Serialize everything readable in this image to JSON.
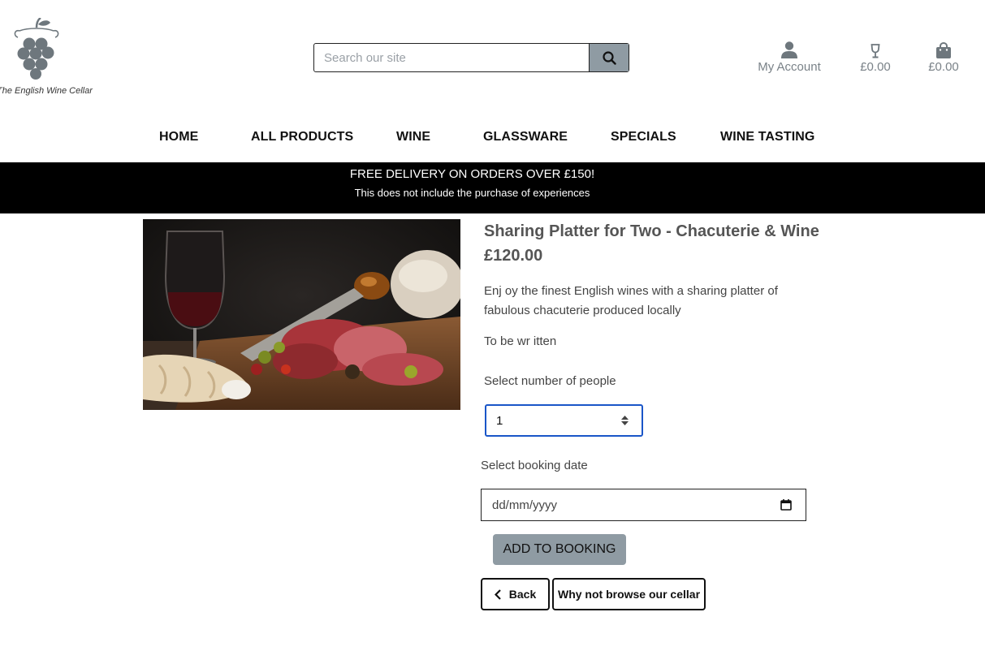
{
  "header": {
    "logo_text": "The English Wine Cellar",
    "search": {
      "placeholder": "Search our site"
    },
    "account_label": "My Account",
    "wishlist_total": "£0.00",
    "bag_total": "£0.00"
  },
  "nav": {
    "items": [
      "HOME",
      "ALL PRODUCTS",
      "WINE",
      "GLASSWARE",
      "SPECIALS",
      "WINE TASTING"
    ]
  },
  "banner": {
    "line1": "FREE DELIVERY ON ORDERS OVER £150!",
    "line2": "This does not include the purchase of experiences"
  },
  "product": {
    "title": "Sharing Platter for Two - Chacuterie & Wine",
    "price": "£120.00",
    "description": "Enj oy the finest English wines with a sharing platter of fabulous chacuterie produced locally",
    "description2": "To be wr itten",
    "people_label": "Select number of people",
    "people_value": "1",
    "date_label": "Select booking date",
    "date_placeholder": "dd/mm/yyyy",
    "add_button": "ADD TO BOOKING",
    "back_button": "Back",
    "browse_button": "Why not browse our cellar"
  },
  "colors": {
    "accent_grey": "#8f9ba3",
    "banner_bg": "#000000",
    "focus_blue": "#1a56c8"
  }
}
